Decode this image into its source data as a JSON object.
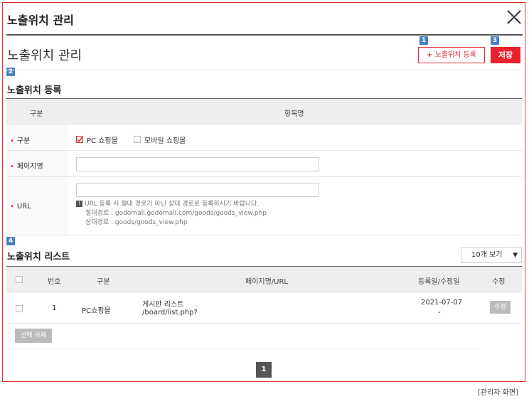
{
  "window": {
    "title": "노출위치 관리"
  },
  "page": {
    "title": "노출위치 관리"
  },
  "markers": [
    "1",
    "2",
    "3",
    "4"
  ],
  "toolbar": {
    "add_icon": "+",
    "add_label": "노출위치 등록",
    "save_label": "저장"
  },
  "register": {
    "section_title": "노출위치 등록",
    "header": {
      "col1": "구분",
      "col2": "항목명"
    },
    "rows": {
      "type": {
        "label": "구분",
        "options": [
          {
            "label": "PC 쇼핑몰",
            "checked": true
          },
          {
            "label": "모바일 쇼핑몰",
            "checked": false
          }
        ]
      },
      "page_name": {
        "label": "페이지명",
        "value": ""
      },
      "url": {
        "label": "URL",
        "value": "",
        "help_icon": "!",
        "help": "URL 등록 시 절대 경로가 아닌 상대 경로로 등록하시기 바랍니다.",
        "absolute_example": "절대경로 : godomall.godomall.com/goods/goods_view.php",
        "relative_example": "상대경로 : goods/goods_view.php"
      }
    }
  },
  "list": {
    "section_title": "노출위치 리스트",
    "page_size": "10개 보기",
    "columns": {
      "no": "번호",
      "type": "구분",
      "page_url": "페이지명/URL",
      "date": "등록일/수정일",
      "edit": "수정"
    },
    "rows": [
      {
        "checked": false,
        "no": "1",
        "type": "PC쇼핑몰",
        "page_name": "게시판 리스트",
        "url": "/board/list.php?",
        "date": "2021-07-07",
        "modified": "-",
        "edit_label": "수정"
      }
    ],
    "delete_label": "선택 삭제",
    "pagination": {
      "current": "1"
    }
  },
  "caption": "[관리자 화면]",
  "colors": {
    "accent": "#e0303a",
    "marker": "#4a7fc1",
    "header_bg": "#eeeeee"
  }
}
